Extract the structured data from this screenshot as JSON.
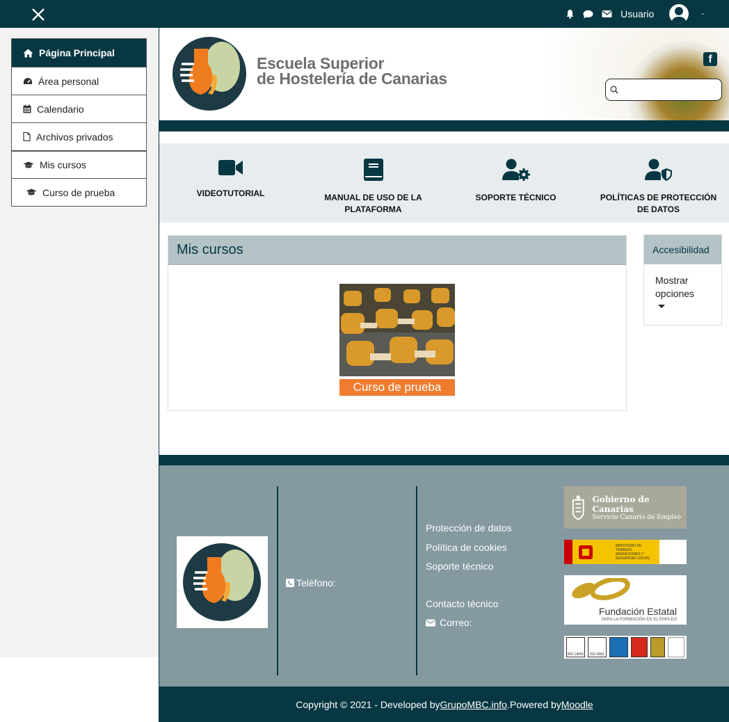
{
  "topbar": {
    "user_label": "Usuario",
    "user_caret": "-"
  },
  "sidebar": {
    "items": [
      {
        "label": "Página Principal",
        "icon": "home-icon"
      },
      {
        "label": "Área personal",
        "icon": "dashboard-icon"
      },
      {
        "label": "Calendario",
        "icon": "calendar-icon"
      },
      {
        "label": "Archivos privados",
        "icon": "file-icon"
      },
      {
        "label": "Mis cursos",
        "icon": "graduation-cap-icon"
      },
      {
        "label": "Curso de prueba",
        "icon": "graduation-cap-icon"
      }
    ]
  },
  "header": {
    "school_line1": "Escuela Superior",
    "school_line2": "de Hostelería de Canarias",
    "search_placeholder": ""
  },
  "features": [
    {
      "label": "VIDEOTUTORIAL",
      "icon": "video-camera-icon"
    },
    {
      "label": "MANUAL DE USO DE LA PLATAFORMA",
      "icon": "book-icon"
    },
    {
      "label": "SOPORTE TÉCNICO",
      "icon": "user-gear-icon"
    },
    {
      "label": "POLÍTICAS DE PROTECCIÓN DE DATOS",
      "icon": "user-shield-icon"
    }
  ],
  "my_courses": {
    "title": "Mis cursos",
    "course_name": "Curso de prueba"
  },
  "accessibility": {
    "title": "Accesibilidad",
    "toggle": "Mostrar opciones"
  },
  "footer": {
    "phone_label": "Teléfono:",
    "links": [
      "Protección de datos",
      "Política de cookies",
      "Soporte técnico"
    ],
    "contact_title": "Contacto técnico",
    "mail_label": "Correo:",
    "gob_line1": "Gobierno de Canarias",
    "gob_line2": "Servicio Canario de Empleo",
    "ministry": "MINISTERIO DE TRABAJO, MIGRACIONES Y SEGURIDAD SOCIAL",
    "fundacion": "Fundación Estatal",
    "fundacion_sub": "PARA LA FORMACIÓN EN EL EMPLEO",
    "cert_iso1": "ISO 14001",
    "cert_iso2": "ISO 9001"
  },
  "copyright": {
    "prefix": "Copyright © 2021 - Developed by ",
    "dev_link": "GrupoMBC.info",
    "middle": ".Powered by ",
    "moodle_link": "Moodle"
  },
  "colors": {
    "dark": "#063742",
    "orange": "#f07c30",
    "footer": "#8499a0"
  }
}
